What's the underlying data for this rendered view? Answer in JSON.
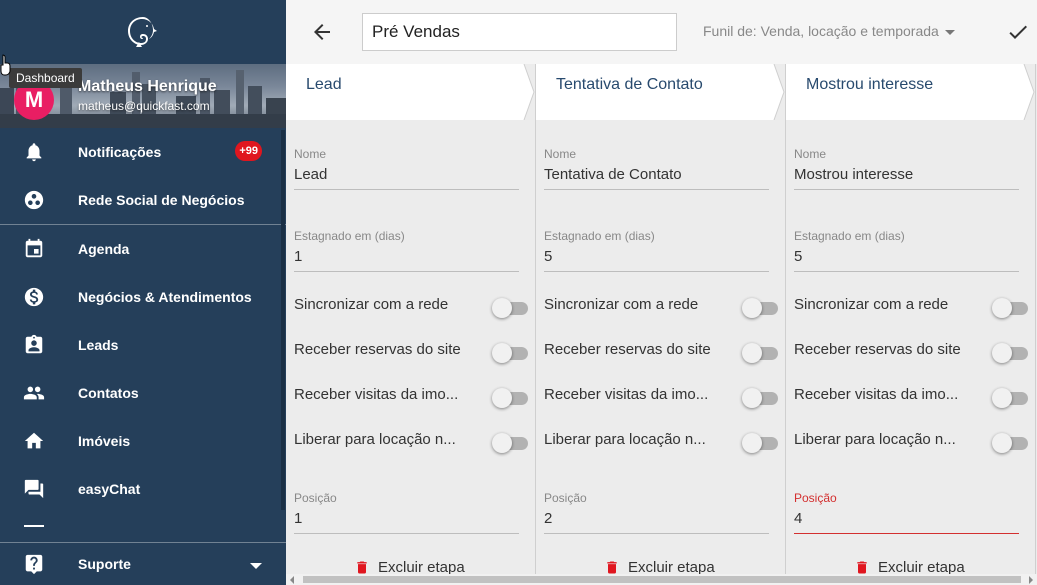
{
  "sidebar": {
    "user": {
      "initial": "M",
      "name": "Matheus Henrique",
      "email": "matheus@quickfast.com"
    },
    "tooltip": "Dashboard",
    "items": [
      {
        "label": "Notificações",
        "icon": "bell-icon",
        "badge": "+99"
      },
      {
        "label": "Rede Social de Negócios",
        "icon": "network-icon"
      },
      {
        "label": "Agenda",
        "icon": "calendar-icon"
      },
      {
        "label": "Negócios & Atendimentos",
        "icon": "dollar-icon"
      },
      {
        "label": "Leads",
        "icon": "leads-icon"
      },
      {
        "label": "Contatos",
        "icon": "contacts-icon"
      },
      {
        "label": "Imóveis",
        "icon": "home-icon"
      },
      {
        "label": "easyChat",
        "icon": "chat-icon"
      }
    ],
    "bottom": {
      "label": "Suporte",
      "icon": "help-icon"
    }
  },
  "topbar": {
    "title_value": "Pré Vendas",
    "funil_label": "Funil de: Venda, locação e temporada"
  },
  "columns": [
    {
      "header": "Lead",
      "name_label": "Nome",
      "name_value": "Lead",
      "stagnant_label": "Estagnado em (dias)",
      "stagnant_value": "1",
      "toggles": [
        "Sincronizar com a rede",
        "Receber reservas do site",
        "Receber visitas da imo...",
        "Liberar para locação n..."
      ],
      "position_label": "Posição",
      "position_value": "1",
      "delete_label": "Excluir etapa"
    },
    {
      "header": "Tentativa de Contato",
      "name_label": "Nome",
      "name_value": "Tentativa de Contato",
      "stagnant_label": "Estagnado em (dias)",
      "stagnant_value": "5",
      "toggles": [
        "Sincronizar com a rede",
        "Receber reservas do site",
        "Receber visitas da imo...",
        "Liberar para locação n..."
      ],
      "position_label": "Posição",
      "position_value": "2",
      "delete_label": "Excluir etapa"
    },
    {
      "header": "Mostrou interesse",
      "name_label": "Nome",
      "name_value": "Mostrou interesse",
      "stagnant_label": "Estagnado em (dias)",
      "stagnant_value": "5",
      "toggles": [
        "Sincronizar com a rede",
        "Receber reservas do site",
        "Receber visitas da imo...",
        "Liberar para locação n..."
      ],
      "position_label": "Posição",
      "position_value": "4",
      "delete_label": "Excluir etapa"
    }
  ],
  "colors": {
    "sidebar_bg": "#253f5a",
    "badge": "#e0161f",
    "header_text": "#284a6e",
    "active_field": "#d32f2f",
    "avatar": "#e91e63"
  }
}
